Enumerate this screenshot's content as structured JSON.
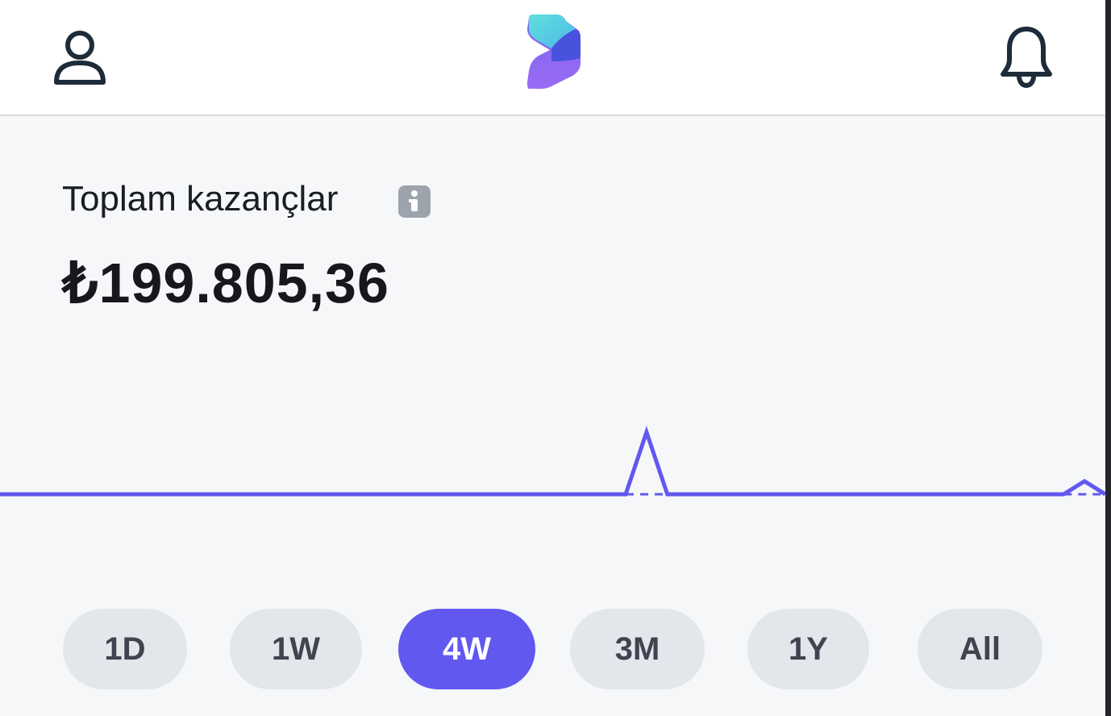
{
  "header": {
    "profile_icon": "user-icon",
    "logo": "app-logo",
    "notification_icon": "bell-icon"
  },
  "earnings": {
    "label": "Toplam kazançlar",
    "info_icon": "info-icon",
    "amount": "₺199.805,36"
  },
  "chart_data": {
    "type": "line",
    "title": "",
    "xlabel": "",
    "ylabel": "",
    "grid": false,
    "legend": "none",
    "series": [
      {
        "values": [
          0,
          0,
          0,
          0,
          0,
          0,
          0,
          0,
          0,
          0,
          0,
          0,
          0,
          0,
          0,
          0,
          0,
          0,
          0,
          0,
          0,
          0,
          0,
          0,
          0,
          0,
          0,
          0,
          0,
          0,
          0,
          1,
          0,
          0,
          0,
          0,
          0,
          0,
          0,
          0,
          0,
          0,
          0,
          0,
          0,
          0,
          0,
          0,
          0,
          0,
          0,
          0,
          0.21,
          0
        ]
      }
    ],
    "baseline": 0,
    "line_color": "#6158f0"
  },
  "ranges": {
    "options": [
      "1D",
      "1W",
      "4W",
      "3M",
      "1Y",
      "All"
    ],
    "selected": "4W"
  },
  "colors": {
    "accent": "#6158f0",
    "pill_bg": "#e3e6ea",
    "pill_text": "#3e4450",
    "page_bg": "#f6f7f9",
    "header_bg": "#ffffff"
  }
}
